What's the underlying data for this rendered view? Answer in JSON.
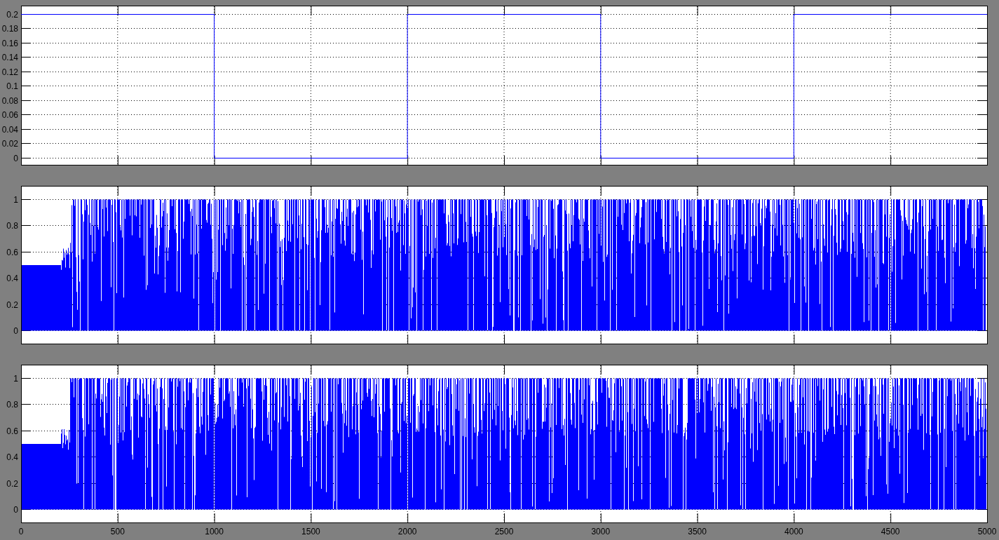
{
  "panels": [
    {
      "kind": "step",
      "yticks": [
        "0.2",
        "0.18",
        "0.16",
        "0.14",
        "0.12",
        "0.1",
        "0.08",
        "0.06",
        "0.04",
        "0.02",
        "0"
      ]
    },
    {
      "kind": "waveform",
      "yticks": [
        "1",
        "0.8",
        "0.6",
        "0.4",
        "0.2",
        "0"
      ]
    },
    {
      "kind": "waveform",
      "yticks": [
        "1",
        "0.8",
        "0.6",
        "0.4",
        "0.2",
        "0"
      ]
    }
  ],
  "x_axis": {
    "tick_labels": [
      "0",
      "500",
      "1000",
      "1500",
      "2000",
      "2500",
      "3000",
      "3500",
      "4000",
      "4500",
      "5000"
    ]
  }
}
